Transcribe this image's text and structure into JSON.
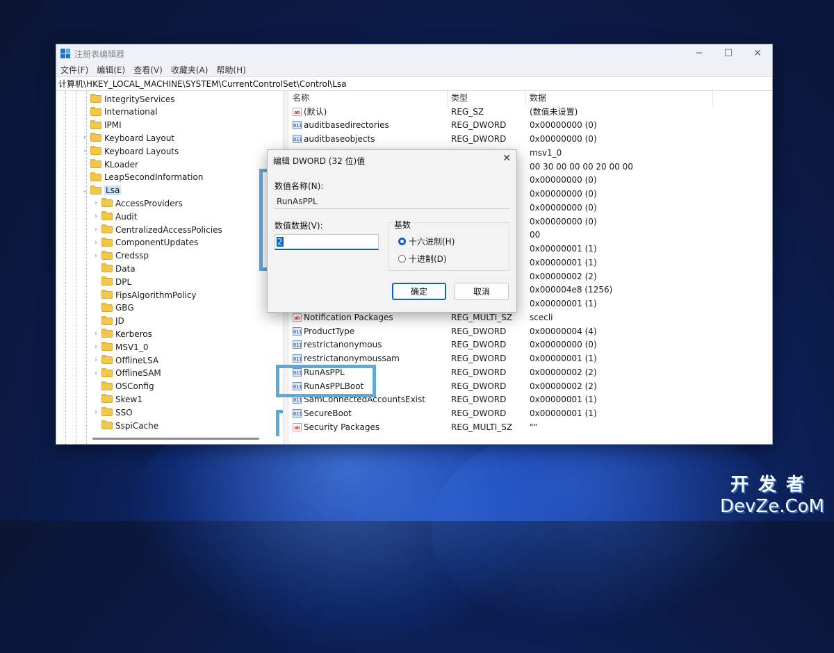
{
  "window": {
    "title": "注册表编辑器",
    "controls": {
      "minimize": "─",
      "maximize": "☐",
      "close": "✕"
    }
  },
  "menu": [
    "文件(F)",
    "编辑(E)",
    "查看(V)",
    "收藏夹(A)",
    "帮助(H)"
  ],
  "address": "计算机\\HKEY_LOCAL_MACHINE\\SYSTEM\\CurrentControlSet\\Control\\Lsa",
  "tree": [
    {
      "label": "IntegrityServices",
      "expandable": false,
      "level": 0
    },
    {
      "label": "International",
      "expandable": false,
      "level": 0
    },
    {
      "label": "IPMI",
      "expandable": false,
      "level": 0
    },
    {
      "label": "Keyboard Layout",
      "expandable": true,
      "level": 0
    },
    {
      "label": "Keyboard Layouts",
      "expandable": true,
      "level": 0
    },
    {
      "label": "KLoader",
      "expandable": false,
      "level": 0
    },
    {
      "label": "LeapSecondInformation",
      "expandable": false,
      "level": 0
    },
    {
      "label": "Lsa",
      "expandable": true,
      "expanded": true,
      "selected": true,
      "level": 0
    },
    {
      "label": "AccessProviders",
      "expandable": true,
      "level": 1
    },
    {
      "label": "Audit",
      "expandable": true,
      "level": 1
    },
    {
      "label": "CentralizedAccessPolicies",
      "expandable": true,
      "level": 1
    },
    {
      "label": "ComponentUpdates",
      "expandable": true,
      "level": 1
    },
    {
      "label": "Credssp",
      "expandable": true,
      "level": 1
    },
    {
      "label": "Data",
      "expandable": false,
      "level": 1
    },
    {
      "label": "DPL",
      "expandable": false,
      "level": 1
    },
    {
      "label": "FipsAlgorithmPolicy",
      "expandable": false,
      "level": 1
    },
    {
      "label": "GBG",
      "expandable": false,
      "level": 1
    },
    {
      "label": "JD",
      "expandable": false,
      "level": 1
    },
    {
      "label": "Kerberos",
      "expandable": true,
      "level": 1
    },
    {
      "label": "MSV1_0",
      "expandable": true,
      "level": 1
    },
    {
      "label": "OfflineLSA",
      "expandable": true,
      "level": 1
    },
    {
      "label": "OfflineSAM",
      "expandable": true,
      "level": 1
    },
    {
      "label": "OSConfig",
      "expandable": false,
      "level": 1
    },
    {
      "label": "Skew1",
      "expandable": false,
      "level": 1
    },
    {
      "label": "SSO",
      "expandable": true,
      "level": 1
    },
    {
      "label": "SspiCache",
      "expandable": false,
      "level": 1
    }
  ],
  "columns": {
    "name": "名称",
    "type": "类型",
    "data": "数据"
  },
  "values": [
    {
      "icon": "ab",
      "name": "(默认)",
      "type": "REG_SZ",
      "data": "(数值未设置)"
    },
    {
      "icon": "bin",
      "name": "auditbasedirectories",
      "type": "REG_DWORD",
      "data": "0x00000000 (0)"
    },
    {
      "icon": "bin",
      "name": "auditbaseobjects",
      "type": "REG_DWORD",
      "data": "0x00000000 (0)"
    },
    {
      "icon": "",
      "name": "",
      "type": "",
      "data": "msv1_0"
    },
    {
      "icon": "",
      "name": "",
      "type": "",
      "data": "00 30 00 00 00 20 00 00"
    },
    {
      "icon": "",
      "name": "",
      "type": "",
      "data": "0x00000000 (0)"
    },
    {
      "icon": "",
      "name": "",
      "type": "",
      "data": "0x00000000 (0)"
    },
    {
      "icon": "",
      "name": "",
      "type": "",
      "data": "0x00000000 (0)"
    },
    {
      "icon": "",
      "name": "",
      "type": "",
      "data": "0x00000000 (0)"
    },
    {
      "icon": "",
      "name": "",
      "type": "",
      "data": "00"
    },
    {
      "icon": "",
      "name": "",
      "type": "",
      "data": "0x00000001 (1)"
    },
    {
      "icon": "",
      "name": "",
      "type": "",
      "data": "0x00000001 (1)"
    },
    {
      "icon": "",
      "name": "",
      "type": "",
      "data": "0x00000002 (2)"
    },
    {
      "icon": "",
      "name": "",
      "type": "",
      "data": "0x000004e8 (1256)"
    },
    {
      "icon": "",
      "name": "",
      "type": "",
      "data": "0x00000001 (1)"
    },
    {
      "icon": "ab",
      "name": "Notification Packages",
      "type": "REG_MULTI_SZ",
      "data": "scecli"
    },
    {
      "icon": "bin",
      "name": "ProductType",
      "type": "REG_DWORD",
      "data": "0x00000004 (4)"
    },
    {
      "icon": "bin",
      "name": "restrictanonymous",
      "type": "REG_DWORD",
      "data": "0x00000000 (0)"
    },
    {
      "icon": "bin",
      "name": "restrictanonymoussam",
      "type": "REG_DWORD",
      "data": "0x00000001 (1)"
    },
    {
      "icon": "bin",
      "name": "RunAsPPL",
      "type": "REG_DWORD",
      "data": "0x00000002 (2)"
    },
    {
      "icon": "bin",
      "name": "RunAsPPLBoot",
      "type": "REG_DWORD",
      "data": "0x00000002 (2)"
    },
    {
      "icon": "bin",
      "name": "SamConnectedAccountsExist",
      "type": "REG_DWORD",
      "data": "0x00000001 (1)"
    },
    {
      "icon": "bin",
      "name": "SecureBoot",
      "type": "REG_DWORD",
      "data": "0x00000001 (1)"
    },
    {
      "icon": "ab",
      "name": "Security Packages",
      "type": "REG_MULTI_SZ",
      "data": "\"\""
    }
  ],
  "dialog": {
    "title": "编辑 DWORD (32 位)值",
    "close": "✕",
    "name_label": "数值名称(N):",
    "name_value": "RunAsPPL",
    "data_label": "数值数据(V):",
    "data_value": "2",
    "radix_label": "基数",
    "radix_hex": "十六进制(H)",
    "radix_dec": "十进制(D)",
    "radix_selected": "hex",
    "ok": "确定",
    "cancel": "取消"
  },
  "watermark": {
    "line1": "开发者",
    "line2": "DevZe.CoM"
  },
  "colors": {
    "highlight": "#5fa8dc",
    "accent": "#0a62c8",
    "folder": "#f2c84b"
  }
}
